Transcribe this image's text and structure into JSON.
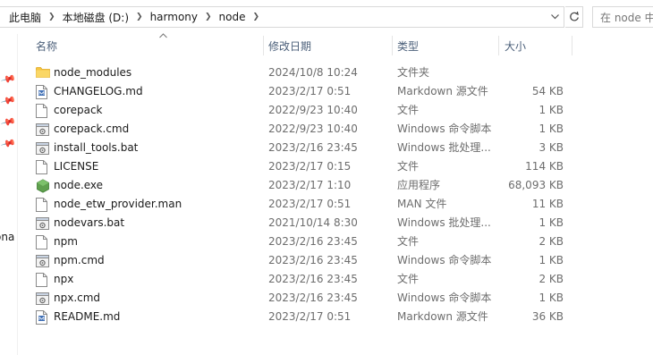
{
  "breadcrumb": {
    "items": [
      "此电脑",
      "本地磁盘 (D:)",
      "harmony",
      "node"
    ],
    "separator": "›",
    "dropdown_icon": "chevron-down-icon"
  },
  "toolbar": {
    "refresh_icon": "refresh-icon",
    "search_placeholder": "在 node 中"
  },
  "nav": {
    "partial_label": "ona"
  },
  "columns": {
    "name": "名称",
    "date": "修改日期",
    "type": "类型",
    "size": "大小"
  },
  "files": [
    {
      "name": "node_modules",
      "date": "2024/10/8 10:24",
      "type": "文件夹",
      "size": "",
      "icon": "folder-icon"
    },
    {
      "name": "CHANGELOG.md",
      "date": "2023/2/17 0:51",
      "type": "Markdown 源文件",
      "size": "54 KB",
      "icon": "markdown-file-icon"
    },
    {
      "name": "corepack",
      "date": "2022/9/23 10:40",
      "type": "文件",
      "size": "1 KB",
      "icon": "file-icon"
    },
    {
      "name": "corepack.cmd",
      "date": "2022/9/23 10:40",
      "type": "Windows 命令脚本",
      "size": "1 KB",
      "icon": "script-file-icon"
    },
    {
      "name": "install_tools.bat",
      "date": "2023/2/16 23:45",
      "type": "Windows 批处理...",
      "size": "3 KB",
      "icon": "script-file-icon"
    },
    {
      "name": "LICENSE",
      "date": "2023/2/17 0:15",
      "type": "文件",
      "size": "114 KB",
      "icon": "file-icon"
    },
    {
      "name": "node.exe",
      "date": "2023/2/17 1:10",
      "type": "应用程序",
      "size": "68,093 KB",
      "icon": "node-app-icon"
    },
    {
      "name": "node_etw_provider.man",
      "date": "2023/2/17 0:51",
      "type": "MAN 文件",
      "size": "11 KB",
      "icon": "file-icon"
    },
    {
      "name": "nodevars.bat",
      "date": "2021/10/14 8:30",
      "type": "Windows 批处理...",
      "size": "1 KB",
      "icon": "script-file-icon"
    },
    {
      "name": "npm",
      "date": "2023/2/16 23:45",
      "type": "文件",
      "size": "2 KB",
      "icon": "file-icon"
    },
    {
      "name": "npm.cmd",
      "date": "2023/2/16 23:45",
      "type": "Windows 命令脚本",
      "size": "1 KB",
      "icon": "script-file-icon"
    },
    {
      "name": "npx",
      "date": "2023/2/16 23:45",
      "type": "文件",
      "size": "2 KB",
      "icon": "file-icon"
    },
    {
      "name": "npx.cmd",
      "date": "2023/2/16 23:45",
      "type": "Windows 命令脚本",
      "size": "1 KB",
      "icon": "script-file-icon"
    },
    {
      "name": "README.md",
      "date": "2023/2/17 0:51",
      "type": "Markdown 源文件",
      "size": "36 KB",
      "icon": "markdown-file-icon"
    }
  ],
  "colors": {
    "folder": "#f5c542",
    "folder_dark": "#e0a922",
    "node_green": "#5fa04e",
    "header_text": "#4c607a",
    "secondary_text": "#6d6d6d"
  }
}
